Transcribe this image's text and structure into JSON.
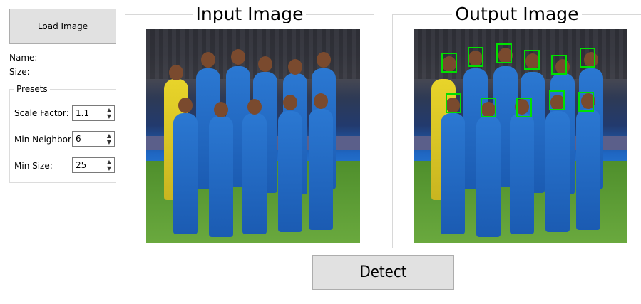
{
  "controls": {
    "load_button_label": "Load Image",
    "name_label": "Name:",
    "size_label": "Size:",
    "detect_button_label": "Detect"
  },
  "presets": {
    "title": "Presets",
    "scale_factor_label": "Scale Factor:",
    "scale_factor_value": "1.1",
    "min_neighbor_label": "Min Neighbor",
    "min_neighbor_value": "6",
    "min_size_label": "Min Size:",
    "min_size_value": "25"
  },
  "panels": {
    "input_title": "Input Image",
    "output_title": "Output Image"
  },
  "colors": {
    "face_box": "#00e000",
    "button_bg": "#e1e1e1"
  }
}
